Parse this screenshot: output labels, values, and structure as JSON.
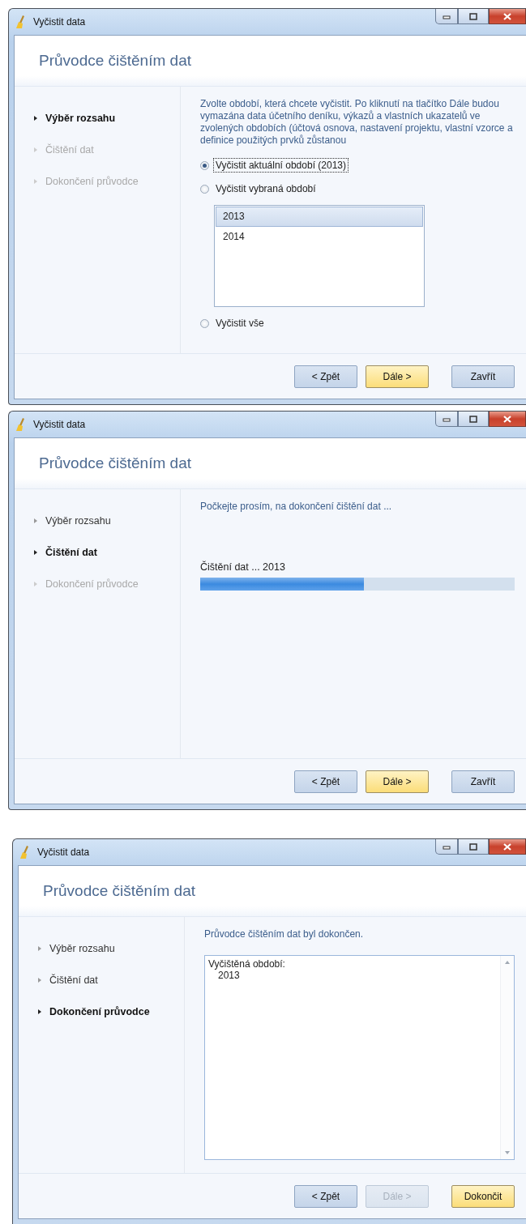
{
  "windows": [
    {
      "title": "Vyčistit data",
      "heading": "Průvodce čištěním dat",
      "steps": [
        {
          "label": "Výběr rozsahu",
          "selected": true,
          "disabled": false
        },
        {
          "label": "Čištění dat",
          "selected": false,
          "disabled": true
        },
        {
          "label": "Dokončení průvodce",
          "selected": false,
          "disabled": true
        }
      ],
      "content": {
        "kind": "selection",
        "intro": "Zvolte období, která chcete vyčistit. Po kliknutí na tlačítko Dále budou vymazána data účetního deníku, výkazů a vlastních ukazatelů ve zvolených obdobích (účtová osnova, nastavení projektu, vlastní vzorce a definice použitých prvků zůstanou",
        "items": [
          {
            "kind": "radio",
            "label": "Vyčistit aktuální období (2013)",
            "selected": true,
            "focused": true
          },
          {
            "kind": "radio",
            "label": "Vyčistit vybraná období",
            "selected": false,
            "focused": false
          },
          {
            "kind": "listbox",
            "items": [
              {
                "label": "2013",
                "selected": true
              },
              {
                "label": "2014",
                "selected": false
              }
            ]
          },
          {
            "kind": "radio",
            "label": "Vyčistit vše",
            "selected": false,
            "focused": false
          }
        ]
      },
      "buttons": [
        {
          "label": "< Zpět",
          "default": false,
          "disabled": false
        },
        {
          "label": "Dále >",
          "default": true,
          "disabled": false
        },
        {
          "label": "Zavřít",
          "default": false,
          "disabled": false
        }
      ]
    },
    {
      "title": "Vyčistit data",
      "heading": "Průvodce čištěním dat",
      "steps": [
        {
          "label": "Výběr rozsahu",
          "selected": false,
          "disabled": false
        },
        {
          "label": "Čištění dat",
          "selected": true,
          "disabled": false
        },
        {
          "label": "Dokončení průvodce",
          "selected": false,
          "disabled": true
        }
      ],
      "content": {
        "kind": "progress",
        "intro": "Počkejte prosím, na dokončení čištění dat ...",
        "status": "Čištění dat ... 2013",
        "level": 0.52
      },
      "buttons": [
        {
          "label": "< Zpět",
          "default": false,
          "disabled": false
        },
        {
          "label": "Dále >",
          "default": true,
          "disabled": false
        },
        {
          "label": "Zavřít",
          "default": false,
          "disabled": false
        }
      ]
    },
    {
      "title": "Vyčistit data",
      "heading": "Průvodce čištěním dat",
      "steps": [
        {
          "label": "Výběr rozsahu",
          "selected": false,
          "disabled": false
        },
        {
          "label": "Čištění dat",
          "selected": false,
          "disabled": false
        },
        {
          "label": "Dokončení průvodce",
          "selected": true,
          "disabled": false
        }
      ],
      "content": {
        "kind": "summary",
        "intro": "Průvodce čištěním dat byl dokončen.",
        "lines": [
          "Vyčištěná období:",
          "2013"
        ]
      },
      "buttons": [
        {
          "label": "< Zpět",
          "default": false,
          "disabled": false
        },
        {
          "label": "Dále >",
          "default": false,
          "disabled": true
        },
        {
          "label": "Dokončit",
          "default": true,
          "disabled": false
        }
      ]
    }
  ]
}
